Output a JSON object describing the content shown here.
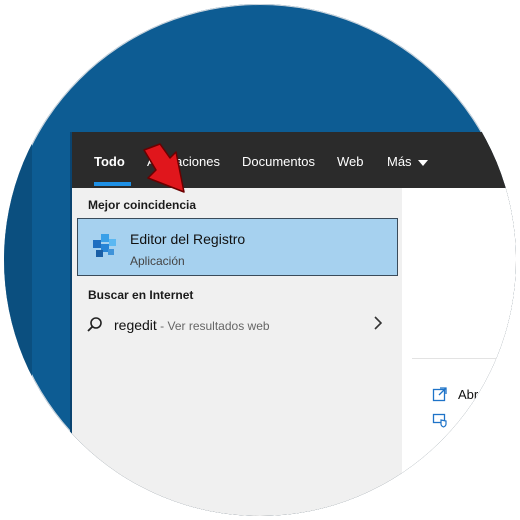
{
  "tabs": [
    {
      "label": "Todo",
      "active": true
    },
    {
      "label": "Aplicaciones"
    },
    {
      "label": "Documentos"
    },
    {
      "label": "Web"
    },
    {
      "label": "Más"
    }
  ],
  "sections": {
    "best_match": "Mejor coincidencia",
    "internet": "Buscar en Internet"
  },
  "best_match_item": {
    "title": "Editor del Registro",
    "subtitle": "Aplicación",
    "icon": "registry-editor-icon"
  },
  "web_result": {
    "query": "regedit",
    "hint": " - Ver resultados web",
    "icon": "search-icon"
  },
  "right_actions": [
    {
      "label": "Abr",
      "icon": "open-icon"
    },
    {
      "label": "",
      "icon": "admin-shield-icon"
    }
  ],
  "colors": {
    "desktop": "#0d5c93",
    "accent": "#1e90e6",
    "highlight": "#a6d1ef",
    "arrow": "#e0161c"
  }
}
